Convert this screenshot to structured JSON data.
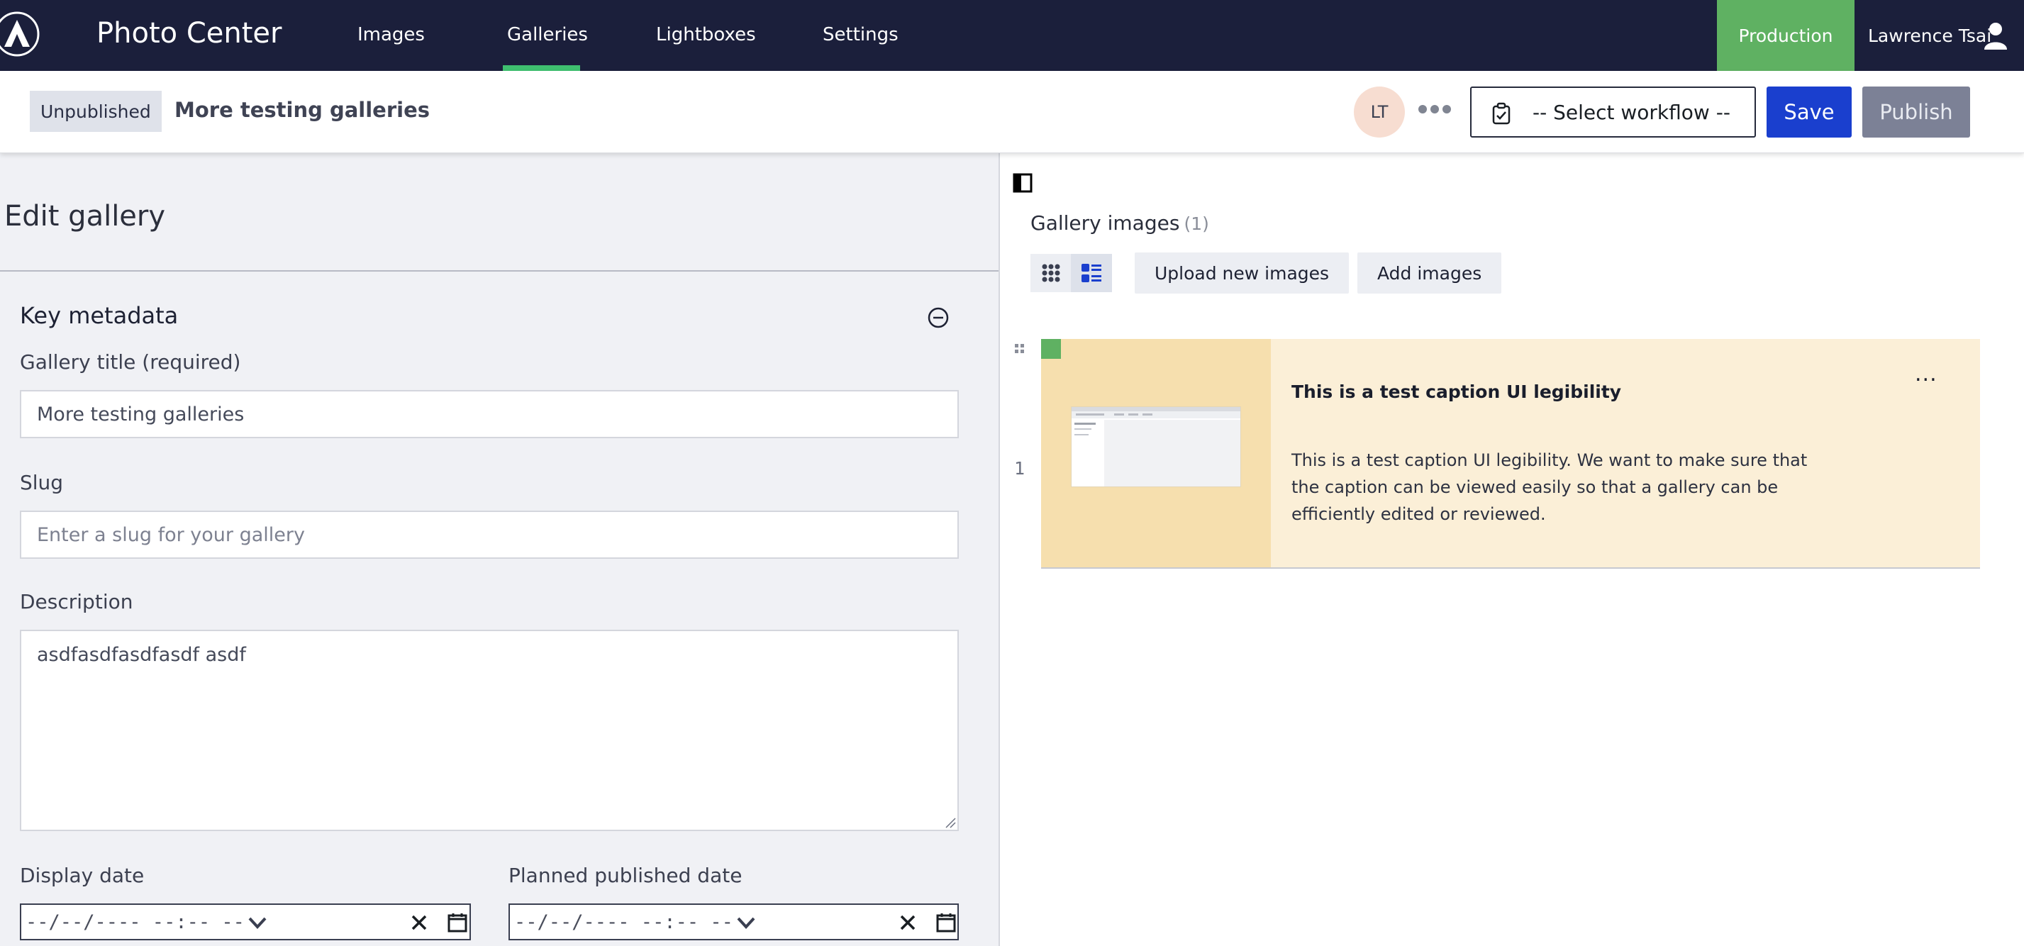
{
  "app": {
    "title": "Photo Center"
  },
  "nav": {
    "items": [
      {
        "label": "Images"
      },
      {
        "label": "Galleries"
      },
      {
        "label": "Lightboxes"
      },
      {
        "label": "Settings"
      }
    ],
    "active": "Galleries"
  },
  "environment": {
    "label": "Production"
  },
  "user": {
    "name": "Lawrence Tsai",
    "initials": "LT"
  },
  "document": {
    "status": "Unpublished",
    "title": "More testing galleries"
  },
  "toolbar": {
    "workflow_placeholder": "-- Select workflow --",
    "save_label": "Save",
    "publish_label": "Publish"
  },
  "edit": {
    "heading": "Edit gallery",
    "section_title": "Key metadata",
    "fields": {
      "title_label": "Gallery title (required)",
      "title_value": "More testing galleries",
      "slug_label": "Slug",
      "slug_placeholder": "Enter a slug for your gallery",
      "description_label": "Description",
      "description_value": "asdfasdfasdfasdf asdf",
      "display_date_label": "Display date",
      "display_date_value": "--/--/---- --:-- --",
      "planned_date_label": "Planned published date",
      "planned_date_value": "--/--/---- --:-- --"
    }
  },
  "gallery": {
    "heading": "Gallery images",
    "count": "(1)",
    "upload_label": "Upload new images",
    "add_label": "Add images",
    "images": [
      {
        "index": "1",
        "caption_title": "This is a test caption UI legibility",
        "caption_body": "This is a test caption UI legibility. We want to make sure that the caption can be viewed easily so that a gallery can be efficiently edited or reviewed.",
        "menu": "..."
      }
    ]
  },
  "colors": {
    "nav_bg": "#1b1f3b",
    "nav_active": "#3fbf6f",
    "production": "#5fb162",
    "save": "#1a3fce",
    "publish_disabled": "#7c8196",
    "card_bg": "#fbefd7",
    "thumb_bg": "#f6dfae"
  },
  "icons": [
    "logo-icon",
    "user-icon",
    "more-icon",
    "workflow-icon",
    "collapse-icon",
    "clear-icon",
    "calendar-icon",
    "chevron-down-icon",
    "panel-toggle-icon",
    "grid-view-icon",
    "list-view-icon",
    "drag-handle-icon"
  ]
}
